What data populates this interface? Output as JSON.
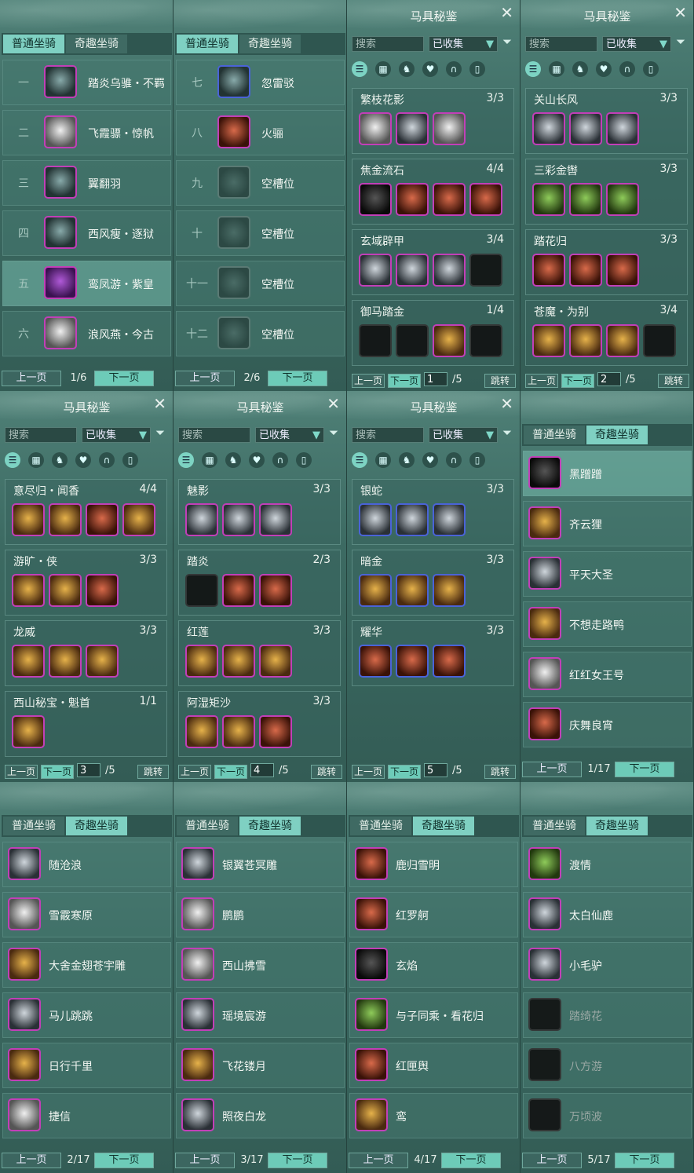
{
  "colors": {
    "accent": "#7fd0c2",
    "rare_border": "#c23fb8",
    "epic_border": "#4a63d8"
  },
  "common": {
    "tab_normal": "普通坐骑",
    "tab_fun": "奇趣坐骑",
    "prev": "上一页",
    "next": "下一页",
    "jump": "跳转",
    "harness_title": "马具秘鉴",
    "search_placeholder": "搜索",
    "filter_value": "已收集"
  },
  "normal_pages": [
    {
      "page": "1/6",
      "rows": [
        {
          "num": "一",
          "name": "踏炎乌骓・不羁",
          "color": "black"
        },
        {
          "num": "二",
          "name": "飞霞骠・惊帆",
          "color": "white"
        },
        {
          "num": "三",
          "name": "翼翻羽",
          "color": "black"
        },
        {
          "num": "四",
          "name": "西风瘦・逐狱",
          "color": "black"
        },
        {
          "num": "五",
          "name": "鸾凤游・紫皇",
          "color": "purple",
          "selected": true
        },
        {
          "num": "六",
          "name": "浪风燕・今古",
          "color": "white"
        }
      ]
    },
    {
      "page": "2/6",
      "rows": [
        {
          "num": "七",
          "name": "忽雷驳",
          "color": "black",
          "blue": true
        },
        {
          "num": "八",
          "name": "火骊",
          "color": "red"
        },
        {
          "num": "九",
          "name": "空槽位",
          "empty": true
        },
        {
          "num": "十",
          "name": "空槽位",
          "empty": true
        },
        {
          "num": "十一",
          "name": "空槽位",
          "empty": true
        },
        {
          "num": "十二",
          "name": "空槽位",
          "empty": true
        }
      ]
    }
  ],
  "harness_pages": [
    {
      "page": "1",
      "total": "/5",
      "sets": [
        {
          "name": "繁枝花影",
          "count": "3/3",
          "items": [
            "white",
            "silver",
            "white"
          ]
        },
        {
          "name": "焦金流石",
          "count": "4/4",
          "items": [
            "dark",
            "red",
            "red",
            "red"
          ]
        },
        {
          "name": "玄域辟甲",
          "count": "3/4",
          "items": [
            "silver",
            "silver",
            "silver",
            "dim"
          ]
        },
        {
          "name": "御马踏金",
          "count": "1/4",
          "items": [
            "dim",
            "dim",
            "gold",
            "dim"
          ]
        }
      ]
    },
    {
      "page": "2",
      "total": "/5",
      "sets": [
        {
          "name": "关山长风",
          "count": "3/3",
          "items": [
            "silver",
            "silver",
            "silver"
          ]
        },
        {
          "name": "三彩金辔",
          "count": "3/3",
          "items": [
            "green",
            "green",
            "green"
          ]
        },
        {
          "name": "踏花归",
          "count": "3/3",
          "items": [
            "red",
            "red",
            "red"
          ]
        },
        {
          "name": "苍魔・为别",
          "count": "3/4",
          "items": [
            "gold",
            "gold",
            "gold",
            "dim"
          ]
        }
      ]
    },
    {
      "page": "3",
      "total": "/5",
      "sets": [
        {
          "name": "意尽归・闻香",
          "count": "4/4",
          "items": [
            "gold",
            "gold",
            "red",
            "gold"
          ]
        },
        {
          "name": "游旷・侠",
          "count": "3/3",
          "items": [
            "gold",
            "gold",
            "red"
          ]
        },
        {
          "name": "龙威",
          "count": "3/3",
          "items": [
            "gold",
            "gold",
            "gold"
          ]
        },
        {
          "name": "西山秘宝・魁首",
          "count": "1/1",
          "items": [
            "gold"
          ]
        }
      ]
    },
    {
      "page": "4",
      "total": "/5",
      "sets": [
        {
          "name": "魅影",
          "count": "3/3",
          "items": [
            "silver",
            "silver",
            "silver"
          ]
        },
        {
          "name": "踏炎",
          "count": "2/3",
          "items": [
            "dim",
            "red",
            "red"
          ]
        },
        {
          "name": "红莲",
          "count": "3/3",
          "items": [
            "gold",
            "gold",
            "gold"
          ]
        },
        {
          "name": "阿湿矩沙",
          "count": "3/3",
          "items": [
            "gold",
            "gold",
            "red"
          ]
        }
      ]
    },
    {
      "page": "5",
      "total": "/5",
      "sets": [
        {
          "name": "银蛇",
          "count": "3/3",
          "items": [
            "silver",
            "silver",
            "silver"
          ],
          "blue": true
        },
        {
          "name": "暗金",
          "count": "3/3",
          "items": [
            "gold",
            "gold",
            "gold"
          ],
          "blue": true
        },
        {
          "name": "耀华",
          "count": "3/3",
          "items": [
            "red",
            "red",
            "red"
          ],
          "blue": true
        }
      ]
    }
  ],
  "fun_pages": [
    {
      "page": "1/17",
      "rows": [
        {
          "name": "黑蹭蹭",
          "color": "dark",
          "selected": true
        },
        {
          "name": "齐云狸",
          "color": "gold"
        },
        {
          "name": "平天大圣",
          "color": "silver"
        },
        {
          "name": "不想走路鸭",
          "color": "gold"
        },
        {
          "name": "红红女王号",
          "color": "white"
        },
        {
          "name": "庆舞良宵",
          "color": "red"
        }
      ]
    },
    {
      "page": "2/17",
      "rows": [
        {
          "name": "随沧浪",
          "color": "silver"
        },
        {
          "name": "雪霰寒原",
          "color": "white"
        },
        {
          "name": "大舍金翅苍宇雕",
          "color": "gold"
        },
        {
          "name": "马儿跳跳",
          "color": "silver"
        },
        {
          "name": "日行千里",
          "color": "gold"
        },
        {
          "name": "捷信",
          "color": "white"
        }
      ]
    },
    {
      "page": "3/17",
      "rows": [
        {
          "name": "银翼苍冥雕",
          "color": "silver"
        },
        {
          "name": "鹏鹏",
          "color": "white"
        },
        {
          "name": "西山拂雪",
          "color": "white"
        },
        {
          "name": "瑶境宸游",
          "color": "silver"
        },
        {
          "name": "飞花镂月",
          "color": "gold"
        },
        {
          "name": "照夜白龙",
          "color": "silver"
        }
      ]
    },
    {
      "page": "4/17",
      "rows": [
        {
          "name": "鹿归雪明",
          "color": "red"
        },
        {
          "name": "红罗舸",
          "color": "red"
        },
        {
          "name": "玄焰",
          "color": "dark"
        },
        {
          "name": "与子同乘・看花归",
          "color": "green"
        },
        {
          "name": "红匣舆",
          "color": "red"
        },
        {
          "name": "鸾",
          "color": "gold"
        }
      ]
    },
    {
      "page": "5/17",
      "rows": [
        {
          "name": "渡情",
          "color": "green"
        },
        {
          "name": "太白仙鹿",
          "color": "silver"
        },
        {
          "name": "小毛驴",
          "color": "silver"
        },
        {
          "name": "踏绮花",
          "color": "dim",
          "grey": true
        },
        {
          "name": "八方游",
          "color": "dim",
          "grey": true
        },
        {
          "name": "万顷波",
          "color": "dim",
          "grey": true
        }
      ]
    }
  ]
}
